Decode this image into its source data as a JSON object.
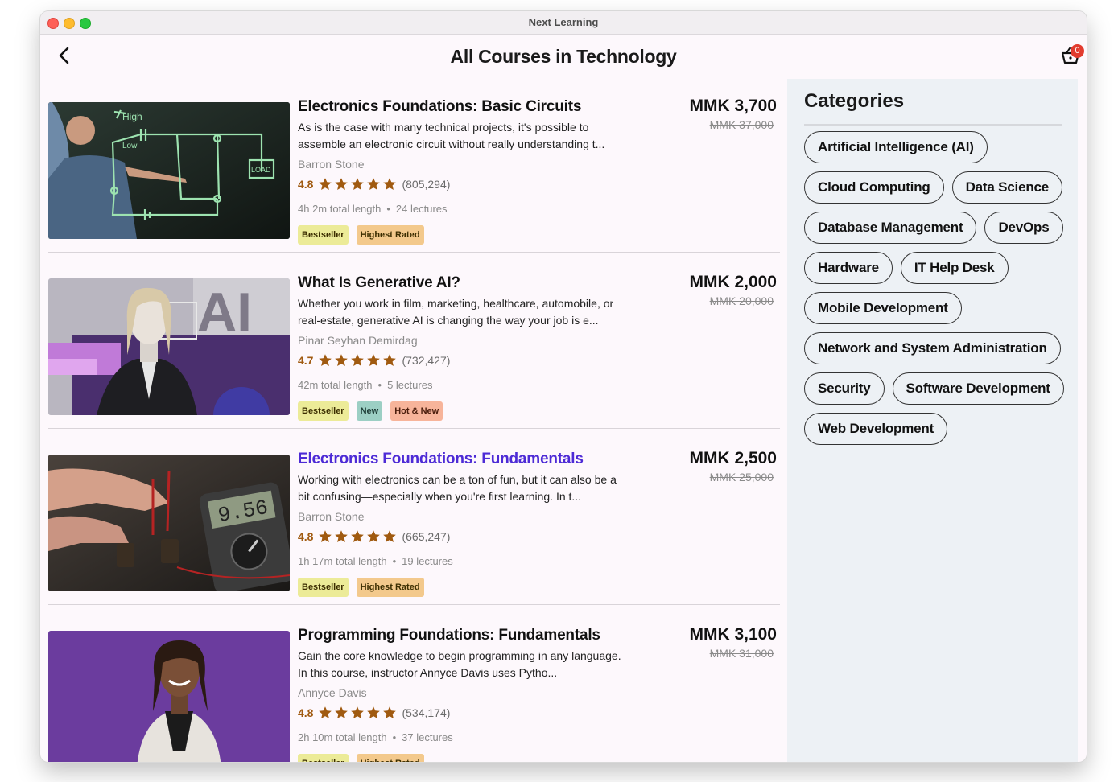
{
  "window": {
    "title": "Next Learning"
  },
  "header": {
    "title": "All Courses in Technology",
    "cart_count": "0",
    "back_icon": "chevron-left-icon",
    "cart_icon": "cart-icon"
  },
  "colors": {
    "accent_link": "#4d2bd6",
    "star": "#a05a10",
    "bestseller": "#eceb98",
    "highest_rated": "#f3c98c",
    "new": "#9ccfc4",
    "hot_new": "#f7b49a"
  },
  "courses": [
    {
      "title": "Electronics Foundations: Basic Circuits",
      "description": "As is the case with many technical projects, it's possible to assemble an electronic circuit without really understanding t...",
      "instructor": "Barron Stone",
      "rating": "4.8",
      "rating_value": 4.8,
      "reviews": "(805,294)",
      "length": "4h 2m total length",
      "lectures": "24 lectures",
      "price": "MMK 3,700",
      "original_price": "MMK 37,000",
      "tags": [
        "Bestseller",
        "Highest Rated"
      ]
    },
    {
      "title": "What Is Generative AI?",
      "description": "Whether you work in film, marketing, healthcare, automobile, or real-estate, generative AI is changing the way your job is e...",
      "instructor": "Pinar Seyhan Demirdag",
      "rating": "4.7",
      "rating_value": 4.7,
      "reviews": "(732,427)",
      "length": "42m total length",
      "lectures": "5 lectures",
      "price": "MMK 2,000",
      "original_price": "MMK 20,000",
      "tags": [
        "Bestseller",
        "New",
        "Hot & New"
      ]
    },
    {
      "title": "Electronics Foundations: Fundamentals",
      "description": "Working with electronics can be a ton of fun, but it can also be a bit confusing—especially when you're first learning. In t...",
      "instructor": "Barron Stone",
      "rating": "4.8",
      "rating_value": 4.8,
      "reviews": "(665,247)",
      "length": "1h 17m total length",
      "lectures": "19 lectures",
      "price": "MMK 2,500",
      "original_price": "MMK 25,000",
      "tags": [
        "Bestseller",
        "Highest Rated"
      ]
    },
    {
      "title": "Programming Foundations: Fundamentals",
      "description": "Gain the core knowledge to begin programming in any language. In this course, instructor Annyce Davis uses Pytho...",
      "instructor": "Annyce Davis",
      "rating": "4.8",
      "rating_value": 4.8,
      "reviews": "(534,174)",
      "length": "2h 10m total length",
      "lectures": "37 lectures",
      "price": "MMK 3,100",
      "original_price": "MMK 31,000",
      "tags": [
        "Bestseller",
        "Highest Rated"
      ]
    }
  ],
  "sidebar": {
    "title": "Categories",
    "categories": [
      "Artificial Intelligence (AI)",
      "Cloud Computing",
      "Data Science",
      "Database Management",
      "DevOps",
      "Hardware",
      "IT Help Desk",
      "Mobile Development",
      "Network and System Administration",
      "Security",
      "Software Development",
      "Web Development"
    ]
  }
}
